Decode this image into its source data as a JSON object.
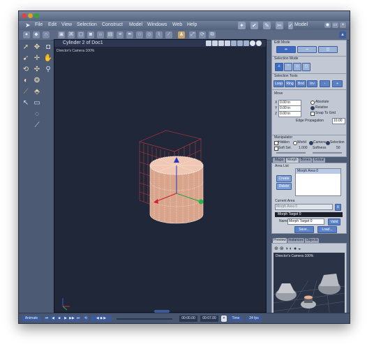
{
  "window": {
    "mode_label": "Model"
  },
  "menu": {
    "items": [
      "File",
      "Edit",
      "View",
      "Selection",
      "Construct",
      "Model",
      "Windows",
      "Web",
      "Help"
    ]
  },
  "viewport": {
    "title": "Cylinder 2 of Doc1",
    "camera_label": "Director's Camera 100%"
  },
  "edit_mode": {
    "label": "Edit Mode"
  },
  "selection_mode": {
    "label": "Selection Mode"
  },
  "selection_tools": {
    "label": "Selection Tools",
    "buttons": [
      "Loop",
      "Ring",
      "Bnd",
      "Inv",
      "-",
      "+"
    ]
  },
  "move": {
    "label": "Move",
    "x_value": "0.00 in",
    "y_value": "0.00 in",
    "z_value": "0.00 in",
    "absolute_label": "Absolute",
    "relative_label": "Relative",
    "snap_label": "Snap To Grid",
    "edge_prop_label": "Edge Propagation",
    "edge_prop_value": "10.00",
    "x_axis": "X",
    "y_axis": "Y",
    "z_axis": "Z"
  },
  "manipulator": {
    "label": "Manipulator",
    "hidden_label": "Hidden",
    "world_label": "World",
    "camera_label": "Camera",
    "selection_label": "Selection",
    "soft_sel_label": "Soft Sel.",
    "soft_sel_value": "1.000",
    "softness_label": "Softness",
    "softness_value": "50"
  },
  "tabs": [
    "Maps",
    "Morph",
    "Bones",
    "Global"
  ],
  "morph": {
    "area_list_label": "Area List",
    "create_label": "Create",
    "delete_label": "Delete",
    "area_items": [
      "Morph Area 0"
    ],
    "current_area_label": "Current Area",
    "current_area_value": "Morph Area 0",
    "target_label": "Morph Target 0",
    "name_label": "Name",
    "name_value": "Morph Target 0",
    "valid_label": "Valid",
    "save_label": "Save...",
    "load_label": "Load..."
  },
  "preview_tabs": [
    "Preview",
    "Instances",
    "Objects"
  ],
  "preview": {
    "camera_label": "Director's Camera 100%"
  },
  "timeline": {
    "animate_label": "Animate",
    "time_start": "00:00.00",
    "time_end": "00:07.00",
    "time_mode": "Time",
    "fps": "24 fps"
  },
  "colors": {
    "accent_blue": "#5b82c6",
    "viewport_bg": "#1f2739",
    "cylinder": "#e6b9a3",
    "grid_red": "#e03030"
  }
}
